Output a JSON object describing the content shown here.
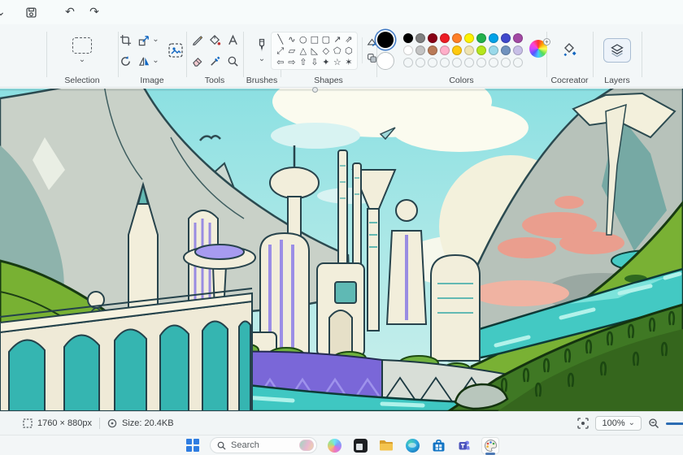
{
  "titlebar": {
    "icons": [
      "overflow-chevron",
      "save",
      "undo",
      "redo"
    ],
    "undo_glyph": "↶",
    "redo_glyph": "↷",
    "chevron_glyph": "⌄"
  },
  "ribbon": {
    "groups": {
      "selection": {
        "label": "Selection"
      },
      "image": {
        "label": "Image"
      },
      "tools": {
        "label": "Tools"
      },
      "brushes": {
        "label": "Brushes"
      },
      "shapes": {
        "label": "Shapes"
      },
      "colors": {
        "label": "Colors"
      },
      "cocreator": {
        "label": "Cocreator"
      },
      "layers": {
        "label": "Layers"
      }
    },
    "shapes_rows": [
      [
        "╲",
        "∿",
        "○",
        "□",
        "▢",
        "↗",
        "⇗"
      ],
      [
        "⤢",
        "▱",
        "△",
        "◺",
        "◇",
        "⬠",
        "⬡"
      ],
      [
        "⇦",
        "⇨",
        "⇧",
        "⇩",
        "✦",
        "☆",
        "✶"
      ]
    ],
    "colors": {
      "foreground": "#000000",
      "background": "#ffffff",
      "palette_row1": [
        "#000000",
        "#7f7f7f",
        "#880015",
        "#ed1c24",
        "#ff7f27",
        "#fff200",
        "#22b14c",
        "#00a2e8",
        "#3f48cc",
        "#a349a4"
      ],
      "palette_row2": [
        "#ffffff",
        "#c3c3c3",
        "#b97a57",
        "#ffaec9",
        "#ffc90e",
        "#efe4b0",
        "#b5e61d",
        "#99d9ea",
        "#7092be",
        "#c8bfe7"
      ],
      "empty_slots": 10
    }
  },
  "statusbar": {
    "dimensions": "1760 × 880px",
    "file_size": "Size: 20.4KB",
    "zoom": {
      "level": "100%",
      "chevron": "⌄"
    }
  },
  "taskbar": {
    "search": {
      "label": "Search"
    },
    "icons": [
      "start",
      "search",
      "copilot",
      "dark-app",
      "file-explorer",
      "edge",
      "store",
      "teams",
      "paint"
    ]
  },
  "canvas": {
    "artwork": "futuristic-city-valley-illustration",
    "key_colors": {
      "sky": "#8fe0e2",
      "mountain_gray": "#c9d1c8",
      "hill_green": "#79b233",
      "river_teal": "#43c9c3",
      "city_cream": "#f2eedb",
      "wall_purple": "#7a67d8",
      "cloud_pink": "#ea9e8e",
      "outline_dark": "#27434c"
    }
  }
}
